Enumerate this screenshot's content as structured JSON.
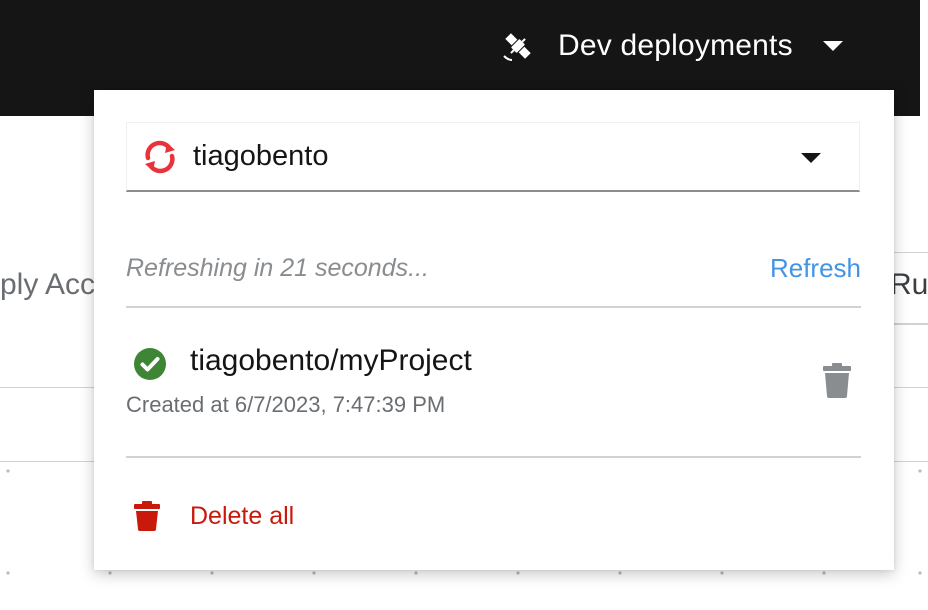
{
  "header": {
    "environment_label": "Dev deployments",
    "environment_icon": "satellite-icon"
  },
  "background": {
    "left_text": "ply Acc",
    "right_text": "Ru"
  },
  "dropdown": {
    "selector": {
      "value": "tiagobento",
      "icon": "openshift-sync-icon"
    },
    "refresh": {
      "status_text": "Refreshing in 21 seconds...",
      "link_label": "Refresh"
    },
    "deployments": [
      {
        "name": "tiagobento/myProject",
        "created": "Created at 6/7/2023, 7:47:39 PM",
        "status": "success",
        "status_icon": "check-circle-icon"
      }
    ],
    "delete_all_label": "Delete all"
  },
  "colors": {
    "topbar": "#151515",
    "link": "#4394e5",
    "danger": "#c9190b",
    "success": "#3e8635",
    "openshift_red": "#e8333a"
  }
}
